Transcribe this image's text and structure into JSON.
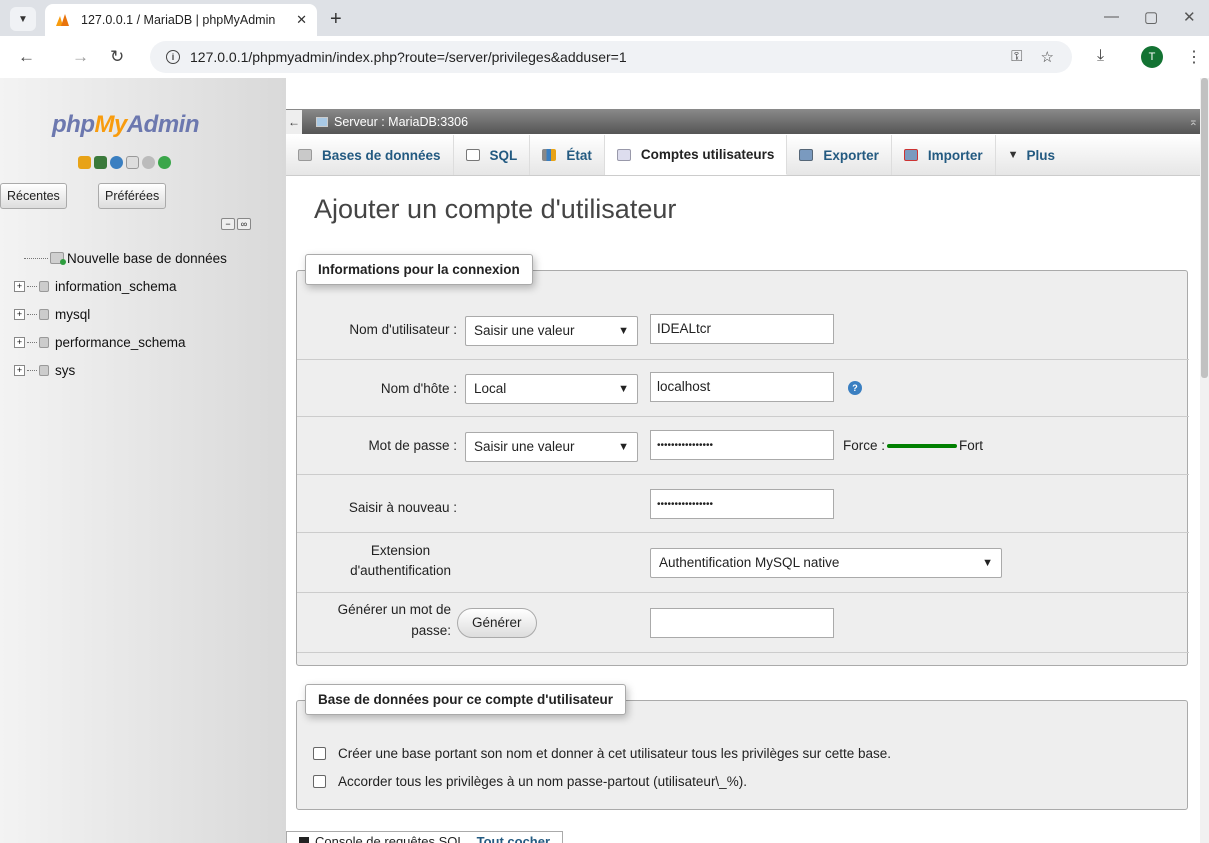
{
  "browser": {
    "tab_title": "127.0.0.1 / MariaDB | phpMyAdmin",
    "tab_close": "✕",
    "new_tab": "+",
    "url": "127.0.0.1/phpmyadmin/index.php?route=/server/privileges&adduser=1",
    "avatar_letter": "T"
  },
  "sidebar": {
    "logo_php": "php",
    "logo_my": "My",
    "logo_admin": "Admin",
    "recent_label": "Récentes",
    "favorites_label": "Préférées",
    "tree": {
      "new_db": "Nouvelle base de données",
      "items": [
        "information_schema",
        "mysql",
        "performance_schema",
        "sys"
      ]
    }
  },
  "main": {
    "server_label": "Serveur : MariaDB:3306",
    "tabs": [
      {
        "label": "Bases de données",
        "icon": "database-icon"
      },
      {
        "label": "SQL",
        "icon": "sql-icon"
      },
      {
        "label": "État",
        "icon": "status-icon"
      },
      {
        "label": "Comptes utilisateurs",
        "icon": "users-icon"
      },
      {
        "label": "Exporter",
        "icon": "export-icon"
      },
      {
        "label": "Importer",
        "icon": "import-icon"
      },
      {
        "label": "Plus",
        "icon": "chevron-down-icon"
      }
    ],
    "page_title": "Ajouter un compte d'utilisateur",
    "login": {
      "legend": "Informations pour la connexion",
      "username_label": "Nom d'utilisateur :",
      "username_select": "Saisir une valeur",
      "username_value": "IDEALtcr",
      "host_label": "Nom d'hôte :",
      "host_select": "Local",
      "host_value": "localhost",
      "password_label": "Mot de passe :",
      "password_select": "Saisir une valeur",
      "password_value": "••••••••••••••••",
      "strength_label": "Force :",
      "strength_value": "Fort",
      "strength_color": "#008000",
      "retype_label": "Saisir à nouveau :",
      "retype_value": "••••••••••••••••",
      "auth_label_1": "Extension",
      "auth_label_2": "d'authentification",
      "auth_select": "Authentification MySQL native",
      "generate_label_1": "Générer un mot de",
      "generate_label_2": "passe:",
      "generate_button": "Générer",
      "generate_value": ""
    },
    "database": {
      "legend": "Base de données pour ce compte d'utilisateur",
      "option_1": "Créer une base portant son nom et donner à cet utilisateur tous les privilèges sur cette base.",
      "option_2": "Accorder tous les privilèges à un nom passe-partout (utilisateur\\_%)."
    },
    "console_label": "Console de requêtes SQL",
    "check_all": "Tout cocher"
  }
}
